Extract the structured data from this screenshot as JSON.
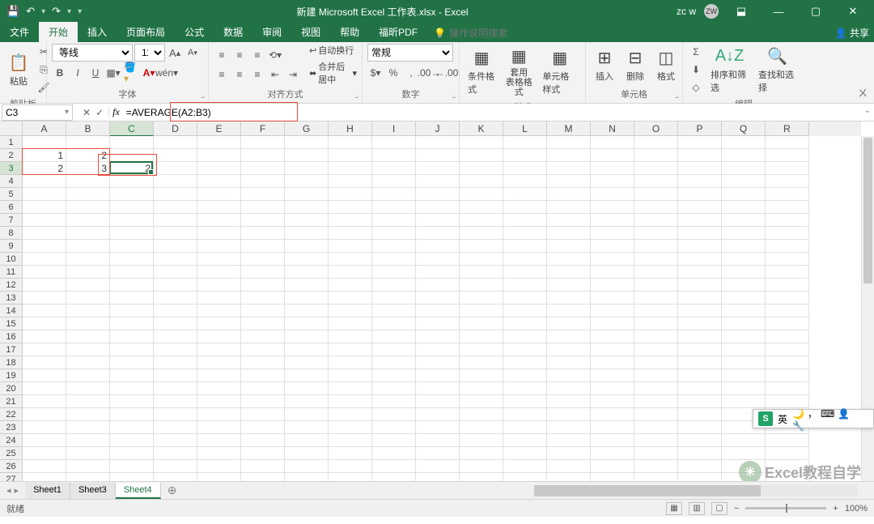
{
  "title": "新建 Microsoft Excel 工作表.xlsx - Excel",
  "user": {
    "name": "zc w",
    "initials": "ZW"
  },
  "qat": {
    "save": "💾",
    "undo": "↶",
    "redo": "↷",
    "more": "▾"
  },
  "win": {
    "min": "—",
    "max": "▢",
    "close": "✕",
    "ribbon_opts": "⬓"
  },
  "tabs": [
    "文件",
    "开始",
    "插入",
    "页面布局",
    "公式",
    "数据",
    "审阅",
    "视图",
    "帮助",
    "福昕PDF"
  ],
  "active_tab": "开始",
  "tell_me": "操作说明搜索",
  "share": "共享",
  "ribbon": {
    "clipboard": {
      "paste": "粘贴",
      "label": "剪贴板",
      "cut": "✂",
      "copy": "⎘",
      "brush": "🖌"
    },
    "font": {
      "name": "等线",
      "size": "11",
      "inc": "A",
      "dec": "A",
      "bold": "B",
      "italic": "I",
      "underline": "U",
      "label": "字体"
    },
    "align": {
      "wrap": "自动换行",
      "wrap_ico": "↩",
      "merge": "合并后居中",
      "merge_ico": "⬌",
      "label": "对齐方式"
    },
    "number": {
      "format": "常规",
      "percent": "%",
      "comma": ",",
      "inc_dec": "←.0 .00→",
      "label": "数字"
    },
    "styles": {
      "cond": "条件格式",
      "table": "套用\n表格格式",
      "cell": "单元格样式",
      "label": "样式"
    },
    "cells": {
      "insert": "插入",
      "delete": "删除",
      "format": "格式",
      "label": "单元格"
    },
    "editing": {
      "sort": "排序和筛选",
      "find": "查找和选择",
      "label": "编辑",
      "sum": "Σ",
      "fill": "⬇",
      "clear": "◇"
    }
  },
  "name_box": "C3",
  "formula": "=AVERAGE(A2:B3)",
  "fx": "fx",
  "columns": [
    "A",
    "B",
    "C",
    "D",
    "E",
    "F",
    "G",
    "H",
    "I",
    "J",
    "K",
    "L",
    "M",
    "N",
    "O",
    "P",
    "Q",
    "R"
  ],
  "rows": 27,
  "sel": {
    "col": 2,
    "row": 2
  },
  "cell_data": {
    "A2": "1",
    "B2": "2",
    "A3": "2",
    "B3": "3",
    "C3": "2"
  },
  "sheets": [
    "Sheet1",
    "Sheet3",
    "Sheet4"
  ],
  "active_sheet": "Sheet4",
  "status": "就绪",
  "zoom": "100%",
  "ime": {
    "badge": "S",
    "lang": "英",
    "items": [
      "🌙",
      "，",
      "⌨",
      "👤",
      "🔧"
    ]
  },
  "watermark": "Excel教程自学"
}
